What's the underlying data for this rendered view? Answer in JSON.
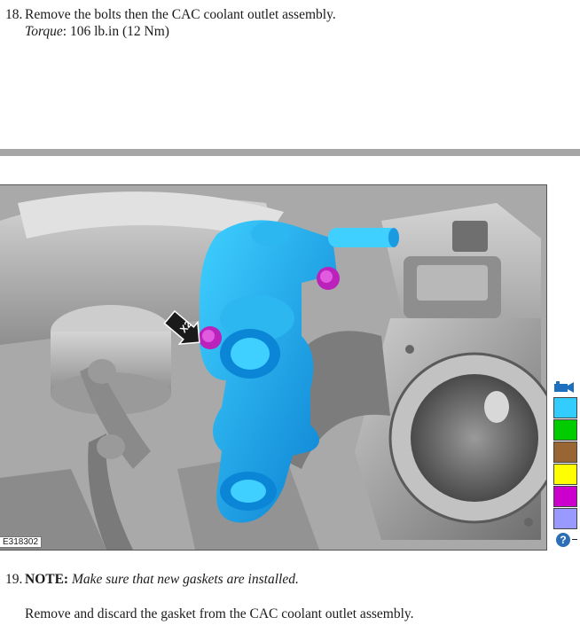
{
  "step18": {
    "number": "18.",
    "text": "Remove the bolts then the CAC coolant outlet assembly.",
    "torque_label": "Torque",
    "torque_value": ": 106 lb.in (12 Nm)"
  },
  "figure": {
    "id": "E318302",
    "callout": "X2",
    "palette": [
      "#33ccff",
      "#00cc00",
      "#996633",
      "#ffff00",
      "#cc00cc",
      "#9999ff"
    ],
    "icons": [
      "camera-icon",
      "help-icon"
    ]
  },
  "step19": {
    "number": "19.",
    "note_label": "NOTE:",
    "note_text": "Make sure that new gaskets are installed.",
    "text": "Remove and discard the gasket from the CAC coolant outlet assembly."
  },
  "help": {
    "glyph": "?"
  }
}
